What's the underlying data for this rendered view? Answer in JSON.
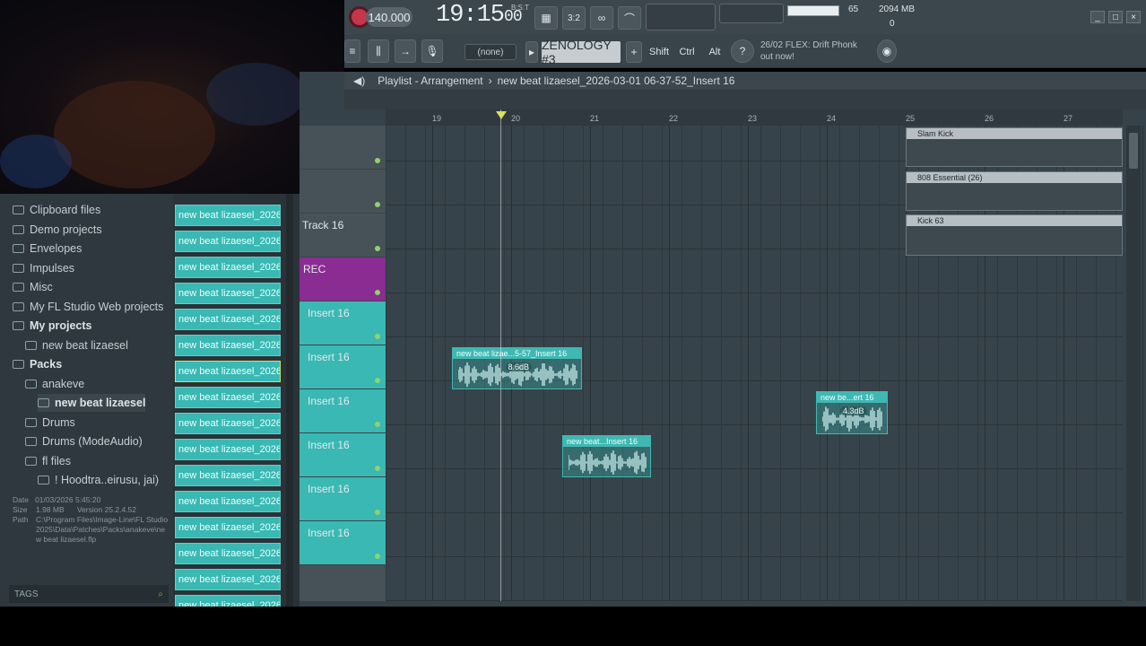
{
  "topbar": {
    "tempo": "140.000",
    "time": "19:15",
    "time_frac": "00",
    "time_small": "B:S:T",
    "pattern_select": "(none)",
    "plugin": "ZENOLOGY #3",
    "mod_keys": [
      "Shift",
      "Ctrl",
      "Alt"
    ],
    "cpu": "65",
    "memory": "2094 MB",
    "polyphony": "0",
    "news_line1": "26/02  FLEX: Drift Phonk",
    "news_line2": "out now!",
    "accent_color": "#3ab8b3"
  },
  "playlist": {
    "breadcrumb": "Playlist - Arrangement",
    "separator": "›",
    "project": "new beat lizaesel_2026-03-01 06-37-52_Insert 16",
    "ruler": [
      "19",
      "20",
      "21",
      "22",
      "23",
      "24",
      "25",
      "26",
      "27"
    ],
    "tracks": [
      {
        "label": "",
        "type": "normal"
      },
      {
        "label": "",
        "type": "normal"
      },
      {
        "label": "Track 16",
        "type": "normal"
      },
      {
        "label": "REC",
        "type": "rec"
      },
      {
        "label": "Insert 16",
        "type": "insert"
      },
      {
        "label": "Insert 16",
        "type": "insert"
      },
      {
        "label": "Insert 16",
        "type": "insert"
      },
      {
        "label": "Insert 16",
        "type": "insert"
      },
      {
        "label": "Insert 16",
        "type": "insert"
      },
      {
        "label": "Insert 16",
        "type": "insert"
      }
    ],
    "pattern_clips": [
      "Slam Kick",
      "808 Essential (26)",
      "Kick 63"
    ],
    "audio_clips": [
      {
        "title": "new beat lizae...5-57_Insert 16",
        "gain": "8.6dB"
      },
      {
        "title": "new beat...Insert 16",
        "gain": ""
      },
      {
        "title": "new be...ert 16",
        "gain": "4.3dB"
      }
    ]
  },
  "browser": {
    "items": [
      {
        "label": "Clipboard files",
        "bold": false
      },
      {
        "label": "Demo projects",
        "bold": false
      },
      {
        "label": "Envelopes",
        "bold": false
      },
      {
        "label": "Impulses",
        "bold": false
      },
      {
        "label": "Misc",
        "bold": false
      },
      {
        "label": "My FL Studio Web projects",
        "bold": false
      },
      {
        "label": "My projects",
        "bold": true
      },
      {
        "label": "new beat lizaesel",
        "bold": false
      },
      {
        "label": "Packs",
        "bold": true
      },
      {
        "label": "anakeve",
        "bold": false
      },
      {
        "label": "new beat lizaesel",
        "bold": true
      },
      {
        "label": "Drums",
        "bold": false
      },
      {
        "label": "Drums (ModeAudio)",
        "bold": false
      },
      {
        "label": "fl files",
        "bold": false
      },
      {
        "label": "! Hoodtra..eirusu, jai)",
        "bold": false
      }
    ],
    "info_date_label": "Date",
    "info_date": "01/03/2026 5:45:20",
    "info_size_label": "Size",
    "info_size": "1.98 MB",
    "info_version_label": "Version",
    "info_version": "25.2.4.52",
    "info_path_label": "Path",
    "info_path": "C:\\Program Files\\Image-Line\\FL Studio 2025\\Data\\Patches\\Packs\\anakeve\\new beat lizaesel.flp",
    "tags_label": "TAGS"
  },
  "channels": {
    "label": "new beat lizaesel_2026-",
    "count": 16
  }
}
